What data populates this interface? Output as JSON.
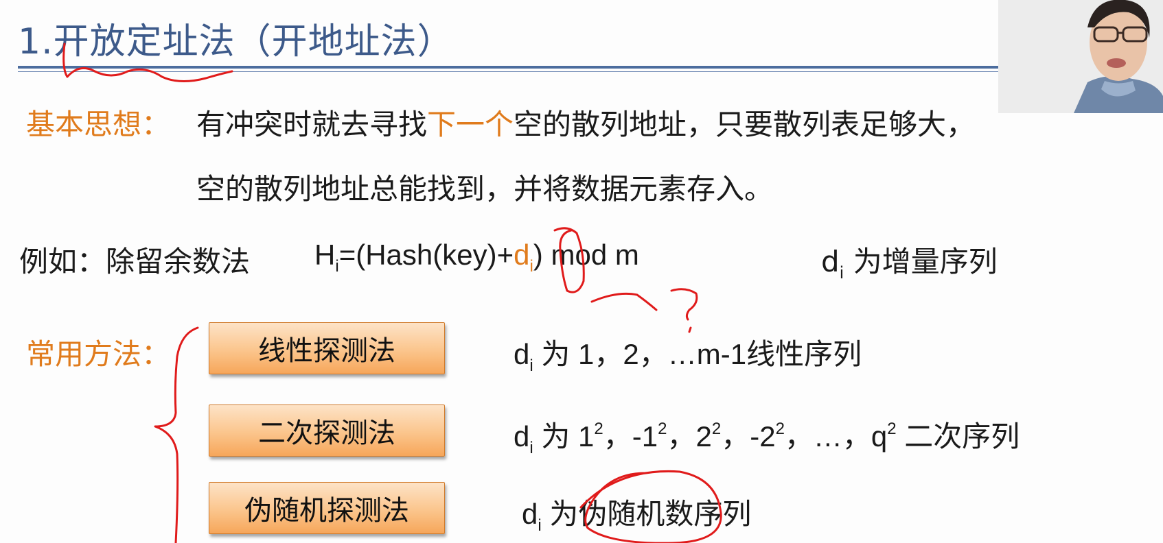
{
  "title": "1.开放定址法（开地址法）",
  "basic_idea": {
    "label": "基本思想：",
    "line1_pre": "有冲突时就去寻找",
    "line1_highlight": "下一个",
    "line1_post": "空的散列地址，只要散列表足够大，",
    "line2": "空的散列地址总能找到，并将数据元素存入。"
  },
  "example": {
    "prefix": "例如：除留余数法",
    "h": "H",
    "h_sub": "i",
    "formula_mid": "=(Hash(key)+",
    "d": "d",
    "d_sub": "i",
    "formula_end": ") mod m",
    "inc_d": "d",
    "inc_sub": "i",
    "inc_text": " 为增量序列"
  },
  "common_methods": {
    "label": "常用方法：",
    "methods": [
      {
        "button": "线性探测法",
        "d": "d",
        "sub": "i",
        "desc": " 为 1，2，…m-1线性序列"
      },
      {
        "button": "二次探测法",
        "d": "d",
        "sub": "i",
        "desc_a": " 为 1",
        "sup": "2",
        "desc_b": "，-1",
        "desc_c": "，2",
        "desc_d": "，-2",
        "desc_e": "，…，q",
        "desc_f": " 二次序列"
      },
      {
        "button": "伪随机探测法",
        "d": "d",
        "sub": "i",
        "desc": " 为伪随机数序列"
      }
    ]
  },
  "colors": {
    "title": "#3d5a8a",
    "accent": "#e07b1c",
    "button_fill": "#fbc58c",
    "annotation": "#e01b1b"
  },
  "webcam": {
    "icon": "presenter-video-icon"
  }
}
